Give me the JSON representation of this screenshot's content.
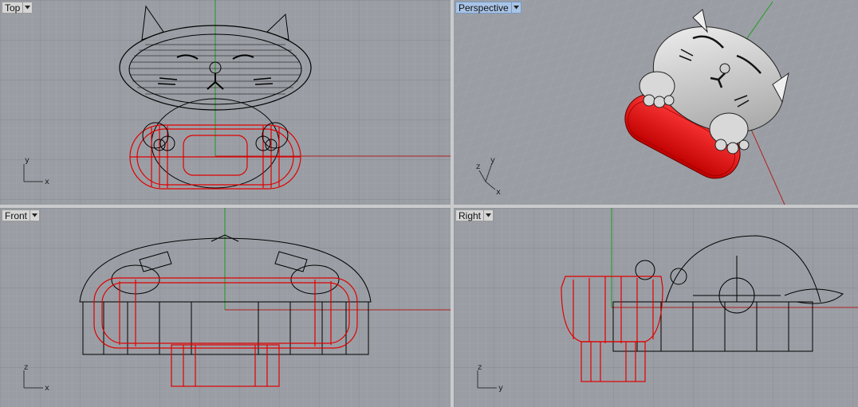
{
  "viewports": {
    "top": {
      "label": "Top",
      "axis_a": "x",
      "axis_b": "y"
    },
    "perspective": {
      "label": "Perspective",
      "axis_a": "x",
      "axis_b": "y",
      "axis_c": "z"
    },
    "front": {
      "label": "Front",
      "axis_a": "x",
      "axis_b": "z"
    },
    "right": {
      "label": "Right",
      "axis_a": "y",
      "axis_b": "z"
    }
  },
  "active_viewport": "Perspective",
  "icons": {
    "viewport_menu": "chevron-down-icon"
  },
  "colors": {
    "grid_bg": "#9a9ea4",
    "grid_minor": "#a6aab0",
    "grid_major": "#8a8e94",
    "axis_x": "#b02020",
    "axis_y": "#1f9a1f",
    "selected": "#e00000",
    "wire": "#000000"
  }
}
